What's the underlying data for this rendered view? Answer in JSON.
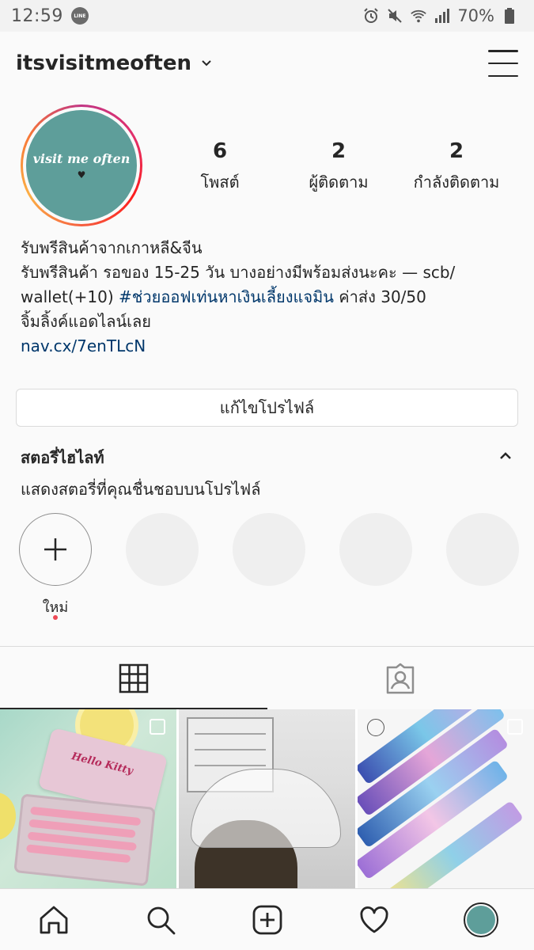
{
  "status_bar": {
    "time": "12:59",
    "app_badge": "LINE",
    "battery": "70%"
  },
  "header": {
    "username": "itsvisitmeoften"
  },
  "profile": {
    "avatar_text": "visit me often",
    "stats": [
      {
        "value": "6",
        "label": "โพสต์"
      },
      {
        "value": "2",
        "label": "ผู้ติดตาม"
      },
      {
        "value": "2",
        "label": "กำลังติดตาม"
      }
    ],
    "bio": {
      "line1": "รับพรีสินค้าจากเกาหลี&จีน",
      "line2": "รับพรีสินค้า รอของ 15-25 วัน บางอย่างมีพร้อมส่งนะคะ — scb/",
      "line3_pre": "wallet(+10) ",
      "line3_tag": "#ช่วยออฟเท่นหาเงินเลี้ยงแจมิน",
      "line3_post": " ค่าส่ง 30/50",
      "line4": "จิ้มลิ้งค์แอดไลน์เลย",
      "link": "nav.cx/7enTLcN"
    },
    "edit_button": "แก้ไขโปรไฟล์"
  },
  "highlights": {
    "title": "สตอรี่ไฮไลท์",
    "subtitle": "แสดงสตอรี่ที่คุณชื่นชอบบนโปรไฟล์",
    "new_label": "ใหม่"
  },
  "colors": {
    "link": "#00376b",
    "border": "#dbdbdb",
    "notification_dot": "#ed4956",
    "avatar_bg": "#5e9e9a"
  },
  "posts": [
    {
      "label": "Hello Kitty"
    },
    {
      "label": ""
    },
    {
      "label": ""
    }
  ],
  "icons": {
    "tabs": [
      "grid-icon",
      "tagged-icon"
    ],
    "nav": [
      "home-icon",
      "search-icon",
      "add-post-icon",
      "activity-heart-icon",
      "profile-avatar"
    ]
  }
}
